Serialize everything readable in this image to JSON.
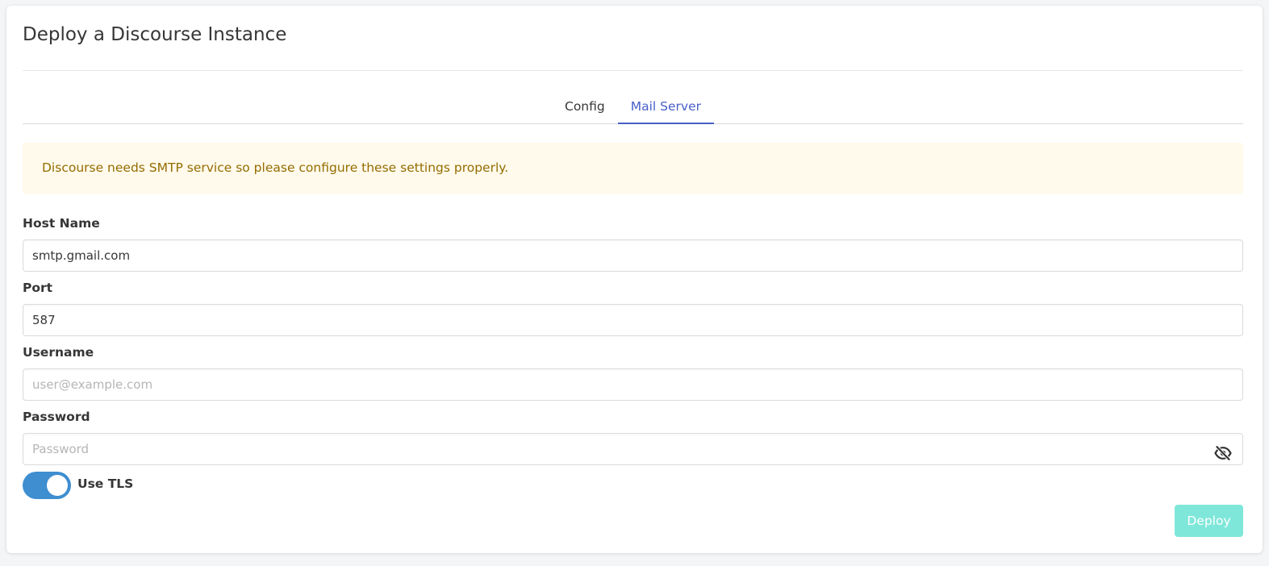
{
  "page": {
    "title": "Deploy a Discourse Instance"
  },
  "tabs": [
    {
      "label": "Config",
      "active": false
    },
    {
      "label": "Mail Server",
      "active": true
    }
  ],
  "notice": {
    "text": "Discourse needs SMTP service so please configure these settings properly."
  },
  "form": {
    "host_name": {
      "label": "Host Name",
      "value": "smtp.gmail.com",
      "placeholder": ""
    },
    "port": {
      "label": "Port",
      "value": "587",
      "placeholder": ""
    },
    "username": {
      "label": "Username",
      "value": "",
      "placeholder": "user@example.com"
    },
    "password": {
      "label": "Password",
      "value": "",
      "placeholder": "Password",
      "toggle_icon": "eye-slash-icon"
    },
    "use_tls": {
      "label": "Use TLS",
      "checked": true
    }
  },
  "actions": {
    "deploy_label": "Deploy",
    "deploy_disabled": true
  },
  "colors": {
    "accent": "#485fc7",
    "toggle_on": "#3e8ed0",
    "notice_bg": "#fffaeb",
    "notice_text": "#946c00",
    "deploy_bg": "#7fe7d9"
  }
}
